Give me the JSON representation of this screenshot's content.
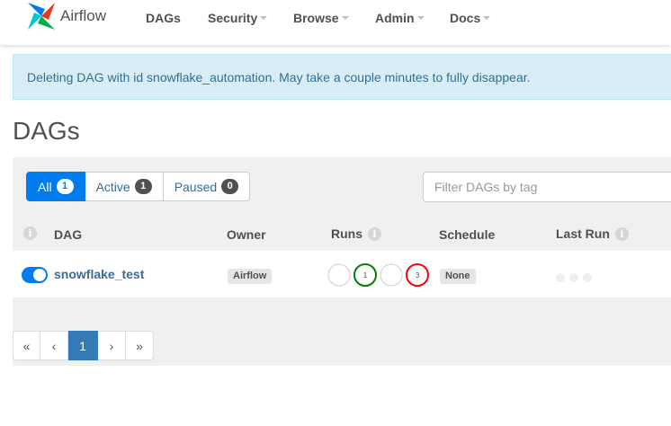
{
  "navbar": {
    "brand": "Airflow",
    "items": [
      {
        "label": "DAGs",
        "dropdown": false
      },
      {
        "label": "Security",
        "dropdown": true
      },
      {
        "label": "Browse",
        "dropdown": true
      },
      {
        "label": "Admin",
        "dropdown": true
      },
      {
        "label": "Docs",
        "dropdown": true
      }
    ]
  },
  "alert": {
    "message": "Deleting DAG with id snowflake_automation. May take a couple minutes to fully disappear."
  },
  "page_title": "DAGs",
  "filters": {
    "all": {
      "label": "All",
      "count": "1"
    },
    "active": {
      "label": "Active",
      "count": "1"
    },
    "paused": {
      "label": "Paused",
      "count": "0"
    },
    "tag_placeholder": "Filter DAGs by tag"
  },
  "table": {
    "headers": {
      "info": "i",
      "dag": "DAG",
      "owner": "Owner",
      "runs": "Runs",
      "schedule": "Schedule",
      "last_run": "Last Run"
    },
    "rows": [
      {
        "dag_id": "snowflake_test",
        "paused": false,
        "owner": "Airflow",
        "runs": [
          {
            "state": "queued",
            "count": "",
            "color": "#cccccc"
          },
          {
            "state": "success",
            "count": "1",
            "color": "#008000"
          },
          {
            "state": "running",
            "count": "",
            "color": "#cccccc"
          },
          {
            "state": "failed",
            "count": "3",
            "color": "#ff0000"
          }
        ],
        "schedule": "None"
      }
    ]
  },
  "pagination": {
    "first": "«",
    "prev": "‹",
    "current": "1",
    "next": "›",
    "last": "»"
  },
  "colors": {
    "accent": "#017cee",
    "link": "#3a6b97",
    "alert_bg": "#d9edf7",
    "alert_text": "#31708f"
  }
}
